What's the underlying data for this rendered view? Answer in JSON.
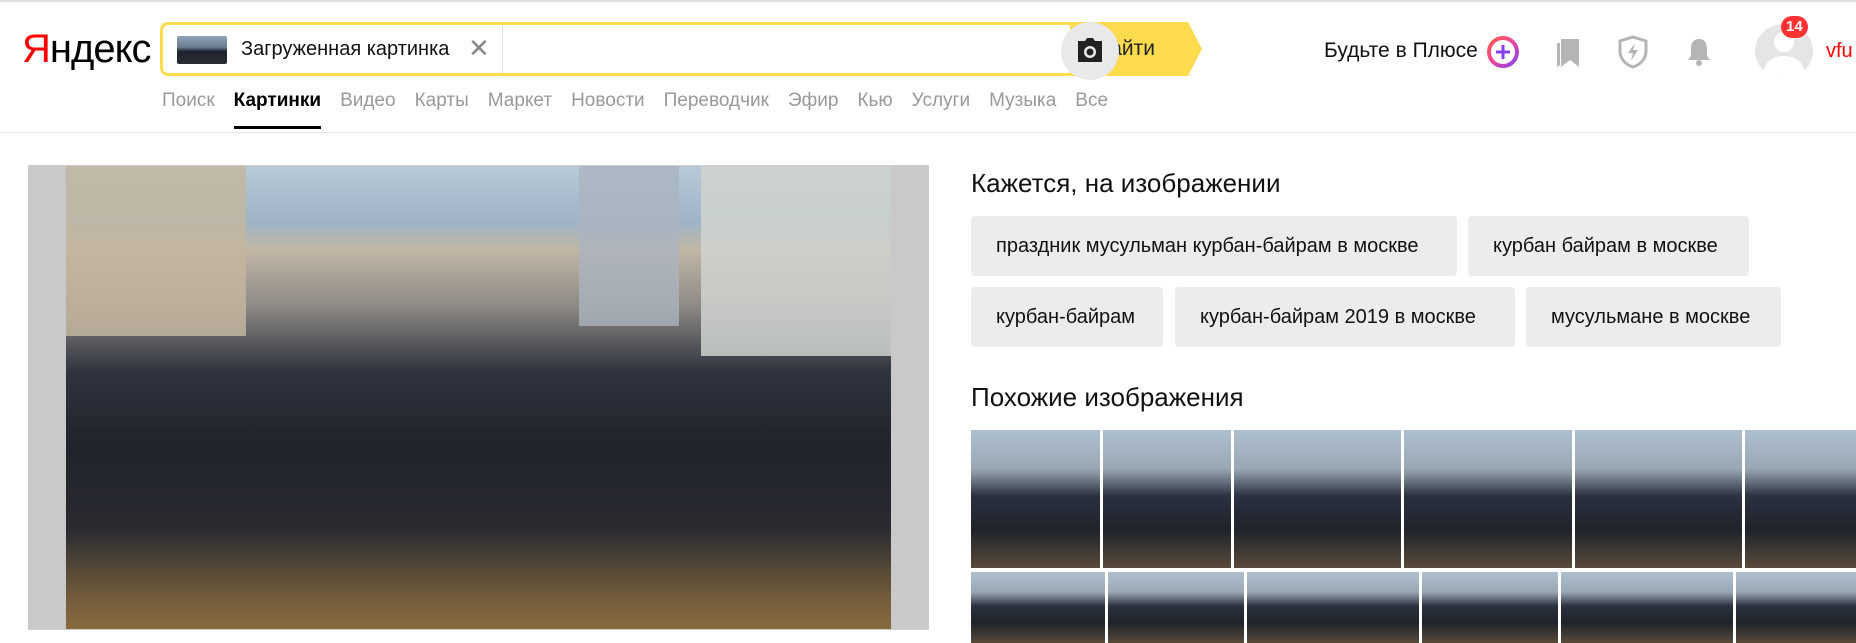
{
  "logo": {
    "first_letter": "Я",
    "rest": "ндекс"
  },
  "search": {
    "chip_label": "Загруженная картинка",
    "close_glyph": "✕",
    "input_value": "",
    "find_label": "Найти"
  },
  "header": {
    "plus_text": "Будьте в Плюсе",
    "notifications_count": "14",
    "username": "vfu"
  },
  "tabs": [
    {
      "label": "Поиск",
      "active": false
    },
    {
      "label": "Картинки",
      "active": true
    },
    {
      "label": "Видео",
      "active": false
    },
    {
      "label": "Карты",
      "active": false
    },
    {
      "label": "Маркет",
      "active": false
    },
    {
      "label": "Новости",
      "active": false
    },
    {
      "label": "Переводчик",
      "active": false
    },
    {
      "label": "Эфир",
      "active": false
    },
    {
      "label": "Кью",
      "active": false
    },
    {
      "label": "Услуги",
      "active": false
    },
    {
      "label": "Музыка",
      "active": false
    },
    {
      "label": "Все",
      "active": false
    }
  ],
  "seems_section": {
    "title": "Кажется, на изображении",
    "tags": [
      "праздник мусульман курбан-байрам в москве",
      "курбан байрам в москве",
      "курбан-байрам",
      "курбан-байрам 2019 в москве",
      "мусульмане в москве"
    ]
  },
  "similar_section": {
    "title": "Похожие изображения"
  }
}
